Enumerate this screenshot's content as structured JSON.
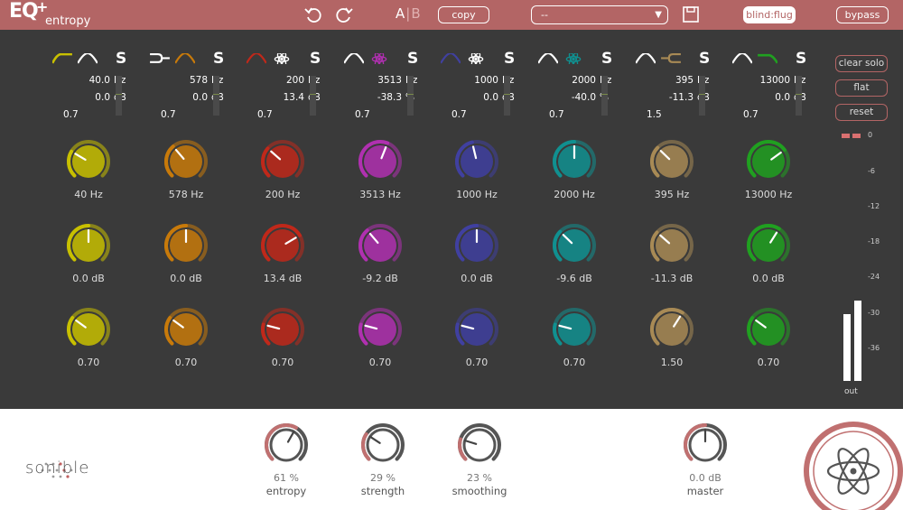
{
  "header": {
    "logo_eq": "EQ",
    "logo_plus": "+",
    "logo_word": "entropy",
    "ab_a": "A",
    "ab_sep": "|",
    "ab_b": "B",
    "copy": "copy",
    "preset": "--",
    "blind": "blind:flug",
    "bypass": "bypass"
  },
  "bands": [
    {
      "id": "1",
      "color": "#c8c000",
      "freq": "40.0",
      "freq_unit": "Hz",
      "gain": "0.0",
      "gain_unit": "dB",
      "q": "0.7",
      "k1_label": "40 Hz",
      "k2_label": "0.0 dB",
      "k3_label": "0.70",
      "k1": 0.28,
      "k2": 0.5,
      "k3": 0.3
    },
    {
      "id": "2",
      "color": "#c87a0a",
      "freq": "578",
      "freq_unit": "Hz",
      "gain": "0.0",
      "gain_unit": "dB",
      "q": "0.7",
      "k1_label": "578 Hz",
      "k2_label": "0.0 dB",
      "k3_label": "0.70",
      "k1": 0.35,
      "k2": 0.5,
      "k3": 0.3
    },
    {
      "id": "3",
      "color": "#c0281a",
      "freq": "200",
      "freq_unit": "Hz",
      "gain": "13.4",
      "gain_unit": "dB",
      "q": "0.7",
      "k1_label": "200 Hz",
      "k2_label": "13.4 dB",
      "k3_label": "0.70",
      "k1": 0.32,
      "k2": 0.72,
      "k3": 0.22
    },
    {
      "id": "4",
      "color": "#b030b0",
      "freq": "3513",
      "freq_unit": "Hz",
      "gain": "-38.3",
      "gain_unit": "%",
      "q": "0.7",
      "k1_label": "3513 Hz",
      "k2_label": "-9.2 dB",
      "k3_label": "0.70",
      "k1": 0.58,
      "k2": 0.35,
      "k3": 0.22
    },
    {
      "id": "5",
      "color": "#4040a0",
      "freq": "1000",
      "freq_unit": "Hz",
      "gain": "0.0",
      "gain_unit": "dB",
      "q": "0.7",
      "k1_label": "1000 Hz",
      "k2_label": "0.0 dB",
      "k3_label": "0.70",
      "k1": 0.45,
      "k2": 0.5,
      "k3": 0.22
    },
    {
      "id": "6",
      "color": "#109090",
      "freq": "2000",
      "freq_unit": "Hz",
      "gain": "-40.0",
      "gain_unit": "%",
      "q": "0.7",
      "k1_label": "2000 Hz",
      "k2_label": "-9.6 dB",
      "k3_label": "0.70",
      "k1": 0.5,
      "k2": 0.33,
      "k3": 0.22
    },
    {
      "id": "7",
      "color": "#a88a55",
      "freq": "395",
      "freq_unit": "Hz",
      "gain": "-11.3",
      "gain_unit": "dB",
      "q": "1.5",
      "k1_label": "395 Hz",
      "k2_label": "-11.3 dB",
      "k3_label": "1.50",
      "k1": 0.33,
      "k2": 0.32,
      "k3": 0.62
    },
    {
      "id": "8",
      "color": "#20a020",
      "freq": "13000",
      "freq_unit": "Hz",
      "gain": "0.0",
      "gain_unit": "dB",
      "q": "0.7",
      "k1_label": "13000 Hz",
      "k2_label": "0.0 dB",
      "k3_label": "0.70",
      "k1": 0.7,
      "k2": 0.62,
      "k3": 0.3
    }
  ],
  "side": {
    "clear_solo": "clear solo",
    "flat": "flat",
    "reset": "reset",
    "ticks": [
      "0",
      "-6",
      "-12",
      "-18",
      "-24",
      "-30",
      "-36"
    ],
    "out": "out"
  },
  "bottom": {
    "brand": "sonible",
    "knobs": [
      {
        "value": "61 %",
        "name": "entropy",
        "amount": 0.61
      },
      {
        "value": "29 %",
        "name": "strength",
        "amount": 0.29
      },
      {
        "value": "23 %",
        "name": "smoothing",
        "amount": 0.23
      },
      {
        "value": "0.0 dB",
        "name": "master",
        "amount": 0.5
      }
    ]
  },
  "colors": {
    "accent": "#b36565",
    "panel": "#3a3a3a"
  }
}
